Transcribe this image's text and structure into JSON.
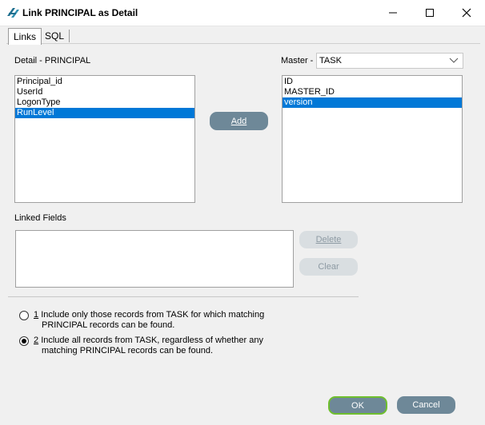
{
  "window": {
    "title": "Link PRINCIPAL as Detail",
    "minimize_label": "—",
    "maximize_label": "☐",
    "close_label": "✕"
  },
  "tabs": [
    {
      "label": "Links",
      "active": true
    },
    {
      "label": "SQL",
      "active": false
    }
  ],
  "detail": {
    "label": "Detail - PRINCIPAL",
    "items": [
      "Principal_id",
      "UserId",
      "LogonType",
      "RunLevel"
    ],
    "selected_index": 3
  },
  "master": {
    "label": "Master -",
    "combo_value": "TASK",
    "items": [
      "ID",
      "MASTER_ID",
      "version"
    ],
    "selected_index": 2
  },
  "buttons": {
    "add": "Add",
    "delete": "Delete",
    "clear": "Clear",
    "ok": "OK",
    "cancel": "Cancel"
  },
  "linked_fields": {
    "label": "Linked Fields",
    "items": []
  },
  "options": [
    {
      "number": "1",
      "line1": "Include only those records from TASK for which matching",
      "line2": "PRINCIPAL records can be found.",
      "checked": false
    },
    {
      "number": "2",
      "line1": "Include all records from TASK, regardless of whether any",
      "line2": "matching PRINCIPAL records can be found.",
      "checked": true
    }
  ],
  "colors": {
    "selection": "#0078d7",
    "button_primary": "#6e8898",
    "ok_border": "#6fbf2e"
  }
}
